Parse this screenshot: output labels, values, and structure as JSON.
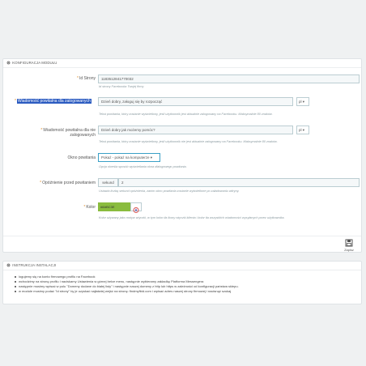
{
  "config_panel": {
    "title": "KONFIGURACJA MODUŁU",
    "fields": {
      "page_id": {
        "label": "Id Strony",
        "value": "1183512841770032",
        "help": "Id strony Facebooka Twojej firmy"
      },
      "greeting_logged": {
        "label": "Wiadomość powitalna dla zalogowanych",
        "value": "Dzień dobry, załoguj się by rozpocząć",
        "lang": "pl",
        "help": "Tekst powitania, który zostanie wyświetlony, jeśli użytkownik jest aktualnie zalogowany na Facebooku. Maksymalnie 80 znaków."
      },
      "greeting_guest": {
        "label": "Wiadomość powitalna dla nie zalogowanych",
        "value": "Dzień dobry jak możemy pomóc?",
        "lang": "pl",
        "help": "Tekst powitania, który zostanie wyświetlony, jeśli użytkownik nie jest aktualnie zalogowany na Facebooku. Maksymalnie 80 znaków."
      },
      "greeting_window": {
        "label": "Okno powitania",
        "selected": "Pokaż - pokaż na komputerze",
        "help": "Opcja określa sposób wyświetlania okna dialogowego powitania."
      },
      "delay": {
        "label": "Opóźnienie przed powitaniem",
        "unit": "sekund",
        "value": "2",
        "help": "Ustawia liczbę sekund opóźnienia, zanim okno powitania zostanie wyświetlone po załadowaniu witryny."
      },
      "color": {
        "label": "Kolor",
        "value": "#8ABC3E",
        "help": "Kolor używany jako motyw wtyczki, w tym kolor tła ikony wtyczki klienta i kolor tła wszystkich wiadomości wysyłanych przez użytkownika."
      }
    },
    "save_label": "Zapisz"
  },
  "install_panel": {
    "title": "INSTRUKCJA INSTALACJI",
    "steps": [
      "logujemy się na konto firmowego profilu na Facebook",
      "wchodzimy na stronę profilu i naciskamy Ustawienia w górnej belce menu, następnie wybieramy zakładkę Platforma Messengera",
      "następnie musimy wpisać w polu \"Domeny dodane do białej listy\" i następnie naszej domeny z http lub https w zależności od konfiguracji państwa sklepu.",
      "w module musimy podać \"id strony\" by je uzyskać najłatwiej wejść na stronę: findmyfbid.com i wpisać adres naszej strony firmowej i nacisnąć szukaj"
    ]
  },
  "colors": {
    "accent": "#25b9d7",
    "swatch": "#8abc3e",
    "required": "#e08f2c"
  }
}
